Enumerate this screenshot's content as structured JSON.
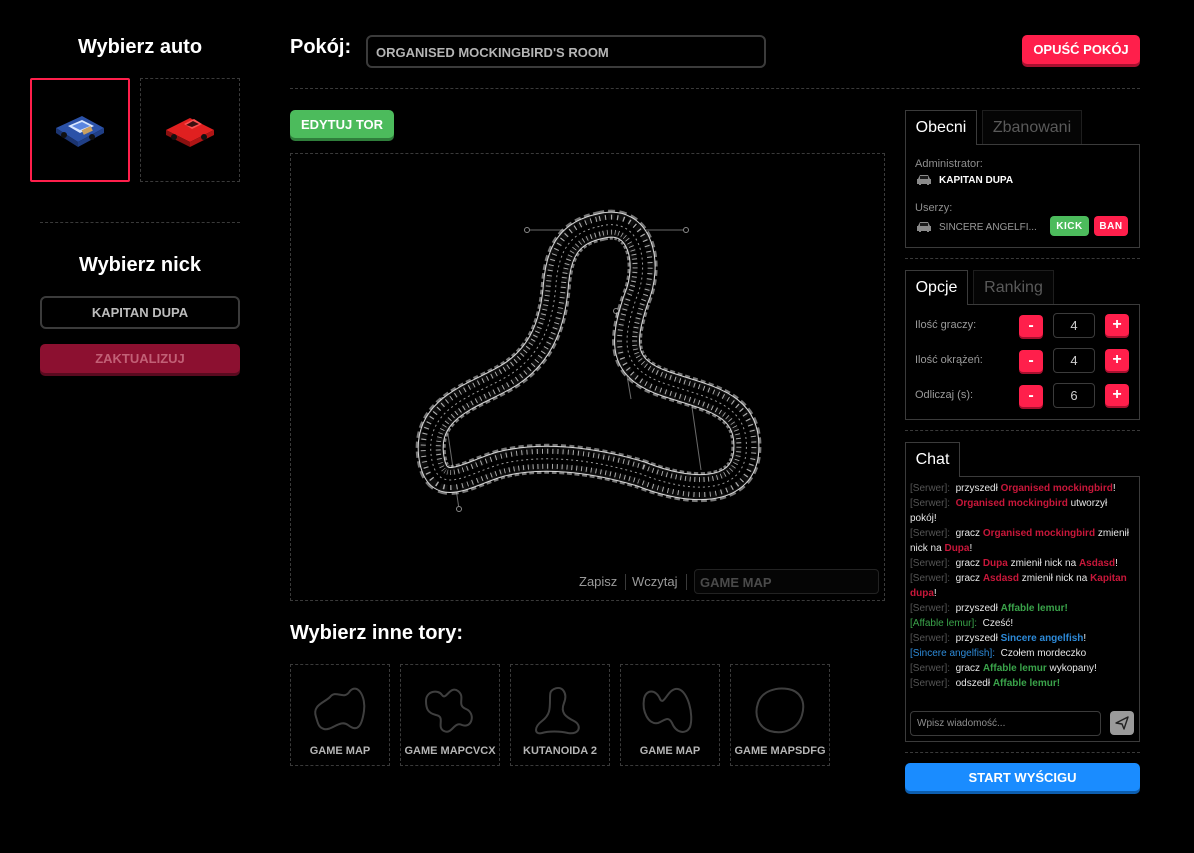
{
  "left": {
    "choose_car_title": "Wybierz auto",
    "cars": [
      {
        "name": "blue-car-icon",
        "color": "#3a6fd8",
        "selected": true
      },
      {
        "name": "red-car-icon",
        "color": "#e02020",
        "selected": false
      }
    ],
    "choose_nick_title": "Wybierz nick",
    "nick_value": "KAPITAN DUPA",
    "update_label": "ZAKTUALIZUJ"
  },
  "header": {
    "room_label": "Pokój:",
    "room_name": "ORGANISED MOCKINGBIRD'S ROOM",
    "leave_label": "OPUŚĆ POKÓJ"
  },
  "editor": {
    "edit_label": "EDYTUJ TOR",
    "save_label": "Zapisz",
    "load_label": "Wczytaj",
    "map_name": "GAME MAP"
  },
  "tracks": {
    "title": "Wybierz inne tory:",
    "items": [
      {
        "name": "GAME MAP"
      },
      {
        "name": "GAME MAPCVCX"
      },
      {
        "name": "KUTANOIDA 2"
      },
      {
        "name": "GAME MAP"
      },
      {
        "name": "GAME MAPSDFG"
      }
    ]
  },
  "players": {
    "tabs": [
      "Obecni",
      "Zbanowani"
    ],
    "admin_label": "Administrator:",
    "admin_name": "KAPITAN DUPA",
    "users_label": "Userzy:",
    "user_name": "SINCERE ANGELFI...",
    "kick_label": "KICK",
    "ban_label": "BAN"
  },
  "options": {
    "tabs": [
      "Opcje",
      "Ranking"
    ],
    "rows": [
      {
        "label": "Ilość graczy:",
        "value": "4"
      },
      {
        "label": "Ilość okrążeń:",
        "value": "4"
      },
      {
        "label": "Odliczaj (s):",
        "value": "6"
      }
    ],
    "minus": "-",
    "plus": "+"
  },
  "chat": {
    "tab": "Chat",
    "placeholder": "Wpisz wiadomość...",
    "start_label": "START WYŚCIGU"
  },
  "colors": {
    "accent_red": "#ff1f4b",
    "accent_green": "#4cbb5c",
    "accent_blue": "#1a8cff"
  }
}
